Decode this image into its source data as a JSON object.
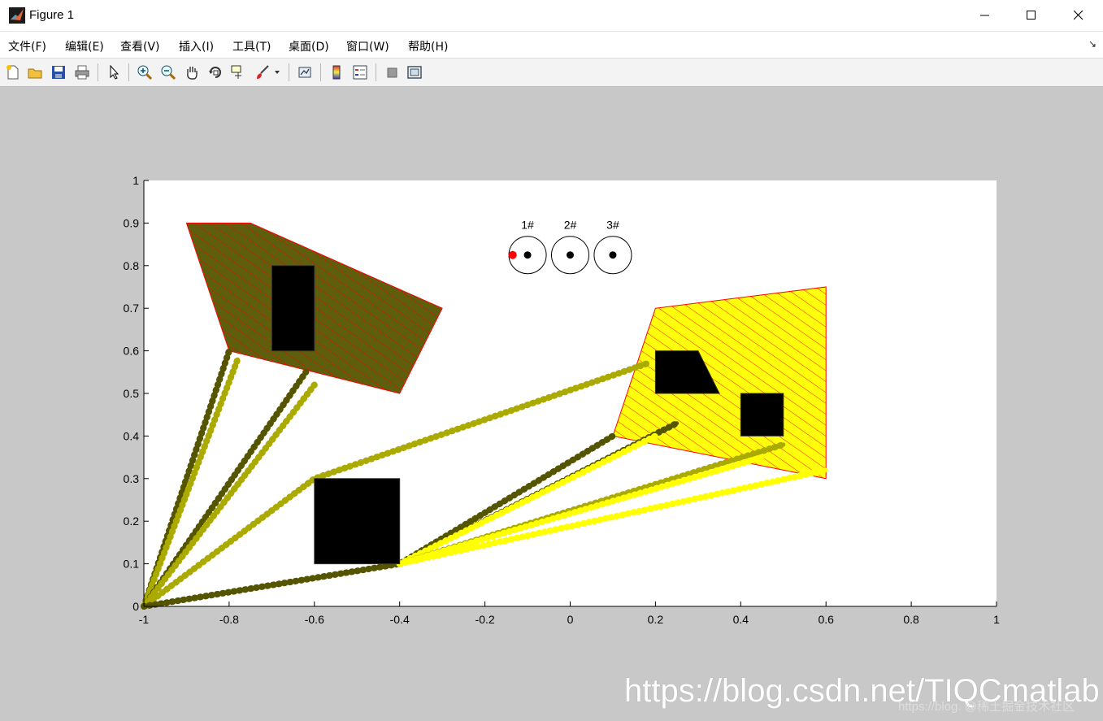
{
  "window": {
    "title": "Figure 1",
    "controls": [
      "minimize",
      "maximize",
      "close"
    ]
  },
  "menu": {
    "items": [
      "文件(F)",
      "编辑(E)",
      "查看(V)",
      "插入(I)",
      "工具(T)",
      "桌面(D)",
      "窗口(W)",
      "帮助(H)"
    ]
  },
  "toolbar": {
    "icons": [
      "new-figure-icon",
      "open-file-icon",
      "save-icon",
      "print-icon",
      "pointer-icon",
      "zoom-in-icon",
      "zoom-out-icon",
      "pan-icon",
      "rotate-3d-icon",
      "data-cursor-icon",
      "brush-icon",
      "link-plot-icon",
      "colorbar-icon",
      "legend-icon",
      "hide-plot-tools-icon",
      "show-plot-tools-icon"
    ]
  },
  "chart_data": {
    "type": "line",
    "title": "",
    "xlabel": "",
    "ylabel": "",
    "xlim": [
      -1,
      1
    ],
    "ylim": [
      0,
      1
    ],
    "x_ticks": [
      "-1",
      "-0.8",
      "-0.6",
      "-0.4",
      "-0.2",
      "0",
      "0.2",
      "0.4",
      "0.6",
      "0.8",
      "1"
    ],
    "y_ticks": [
      "0",
      "0.1",
      "0.2",
      "0.3",
      "0.4",
      "0.5",
      "0.6",
      "0.7",
      "0.8",
      "0.9",
      "1"
    ],
    "grid": false,
    "colors": {
      "robot1": "#555500",
      "robot2": "#aaaa00",
      "robot3": "#ffff00",
      "boundary": "#ff0000",
      "obstacle": "#000000"
    },
    "regions": [
      {
        "name": "region-left",
        "polygon": [
          [
            -0.9,
            0.9
          ],
          [
            -0.75,
            0.9
          ],
          [
            -0.3,
            0.7
          ],
          [
            -0.4,
            0.5
          ],
          [
            -0.8,
            0.6
          ]
        ]
      },
      {
        "name": "region-right",
        "polygon": [
          [
            0.2,
            0.7
          ],
          [
            0.6,
            0.75
          ],
          [
            0.6,
            0.3
          ],
          [
            0.1,
            0.4
          ]
        ]
      }
    ],
    "obstacles": [
      {
        "name": "obstacle-1",
        "polygon": [
          [
            -0.7,
            0.6
          ],
          [
            -0.6,
            0.6
          ],
          [
            -0.6,
            0.8
          ],
          [
            -0.7,
            0.8
          ]
        ]
      },
      {
        "name": "obstacle-2",
        "polygon": [
          [
            -0.6,
            0.1
          ],
          [
            -0.4,
            0.1
          ],
          [
            -0.4,
            0.3
          ],
          [
            -0.6,
            0.3
          ]
        ]
      },
      {
        "name": "obstacle-3",
        "polygon": [
          [
            0.2,
            0.5
          ],
          [
            0.35,
            0.5
          ],
          [
            0.3,
            0.6
          ],
          [
            0.2,
            0.6
          ]
        ]
      },
      {
        "name": "obstacle-4",
        "polygon": [
          [
            0.4,
            0.4
          ],
          [
            0.5,
            0.4
          ],
          [
            0.5,
            0.5
          ],
          [
            0.4,
            0.5
          ]
        ]
      }
    ],
    "paths": [
      {
        "color": "robot1",
        "points": [
          [
            -1,
            0
          ],
          [
            -0.8,
            0.6
          ]
        ]
      },
      {
        "color": "robot2",
        "points": [
          [
            -1,
            0
          ],
          [
            -0.78,
            0.58
          ]
        ]
      },
      {
        "color": "robot1",
        "points": [
          [
            -1,
            0
          ],
          [
            -0.62,
            0.55
          ]
        ]
      },
      {
        "color": "robot2",
        "points": [
          [
            -1,
            0
          ],
          [
            -0.6,
            0.52
          ]
        ]
      },
      {
        "color": "robot2",
        "points": [
          [
            -1,
            0
          ],
          [
            -0.6,
            0.3
          ],
          [
            0.18,
            0.57
          ]
        ]
      },
      {
        "color": "robot1",
        "points": [
          [
            -1,
            0
          ],
          [
            -0.4,
            0.1
          ],
          [
            0.1,
            0.4
          ]
        ]
      },
      {
        "color": "robot1",
        "points": [
          [
            -0.4,
            0.1
          ],
          [
            0.25,
            0.43
          ]
        ]
      },
      {
        "color": "robot3",
        "points": [
          [
            -0.4,
            0.1
          ],
          [
            0.2,
            0.4
          ]
        ]
      },
      {
        "color": "robot2",
        "points": [
          [
            -0.4,
            0.1
          ],
          [
            0.5,
            0.38
          ]
        ]
      },
      {
        "color": "robot3",
        "points": [
          [
            -0.4,
            0.1
          ],
          [
            0.45,
            0.35
          ]
        ]
      },
      {
        "color": "robot3",
        "points": [
          [
            -0.4,
            0.1
          ],
          [
            0.6,
            0.32
          ]
        ]
      }
    ],
    "robots": [
      {
        "label": "1#",
        "x": -0.1,
        "y": 0.825
      },
      {
        "label": "2#",
        "x": 0.0,
        "y": 0.825
      },
      {
        "label": "3#",
        "x": 0.1,
        "y": 0.825
      }
    ],
    "current_position": {
      "x": -0.135,
      "y": 0.825,
      "color": "#ff0000"
    }
  },
  "watermark": {
    "text": "https://blog.csdn.net/TIQCmatlab",
    "overlay": "https://blog.  @稀土掘金技术社区"
  }
}
